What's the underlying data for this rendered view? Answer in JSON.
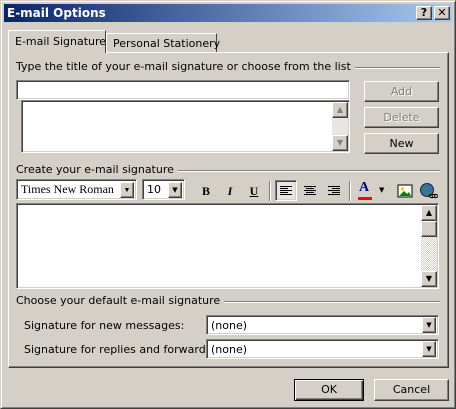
{
  "window": {
    "title": "E-mail Options",
    "help_glyph": "?",
    "close_glyph": "✕"
  },
  "tabs": [
    {
      "label": "E-mail Signature",
      "active": true
    },
    {
      "label": "Personal Stationery",
      "active": false
    }
  ],
  "signature_title_section": {
    "label": "Type the title of your e-mail signature or choose from the list",
    "title_input_value": "",
    "list_items": []
  },
  "list_buttons": {
    "add": "Add",
    "delete": "Delete",
    "new": "New"
  },
  "create_section": {
    "label": "Create your e-mail signature",
    "font_name": "Times New Roman",
    "font_size": "10",
    "bold": "B",
    "italic": "I",
    "underline": "U",
    "font_color_glyph": "A",
    "body_text": ""
  },
  "default_section": {
    "label": "Choose your default e-mail signature",
    "new_messages_label": "Signature for new messages:",
    "new_messages_value": "(none)",
    "replies_label": "Signature for replies and forwards:",
    "replies_value": "(none)"
  },
  "footer": {
    "ok": "OK",
    "cancel": "Cancel"
  },
  "colors": {
    "face": "#d4d0c8",
    "title_start": "#0a246a",
    "title_end": "#a6caf0",
    "font_color_bar": "#ff0000"
  },
  "glyphs": {
    "dropdown": "▼",
    "scroll_up": "▲",
    "scroll_down": "▼"
  }
}
